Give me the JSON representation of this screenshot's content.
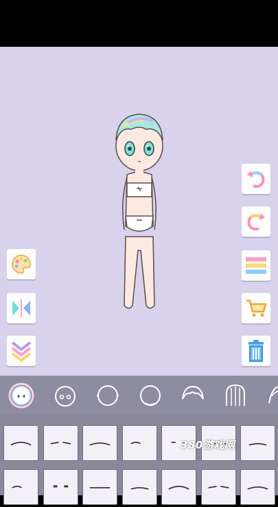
{
  "watermark": {
    "text": "380游戏网"
  },
  "colors": {
    "background": "#d9d2ec",
    "toolbar": "#8e8ca1",
    "palette": "#8a8899",
    "tile": "#f3f1f7"
  },
  "side_buttons_right": [
    {
      "name": "undo-icon"
    },
    {
      "name": "redo-icon"
    },
    {
      "name": "menu-lines-icon"
    },
    {
      "name": "shopping-cart-icon"
    },
    {
      "name": "trash-icon"
    }
  ],
  "side_buttons_left": [
    {
      "name": "color-palette-icon"
    },
    {
      "name": "flip-icon"
    },
    {
      "name": "chevron-down-icon"
    }
  ],
  "categories": [
    {
      "name": "skin-tone-icon",
      "selected": true
    },
    {
      "name": "face-icon"
    },
    {
      "name": "head-shape-icon"
    },
    {
      "name": "head-outline-icon"
    },
    {
      "name": "front-hair-icon"
    },
    {
      "name": "back-hair-icon"
    },
    {
      "name": "hair-extra-icon"
    }
  ],
  "palette_rows": 2,
  "palette_cols": 7,
  "palette_items": "eyebrow-option"
}
